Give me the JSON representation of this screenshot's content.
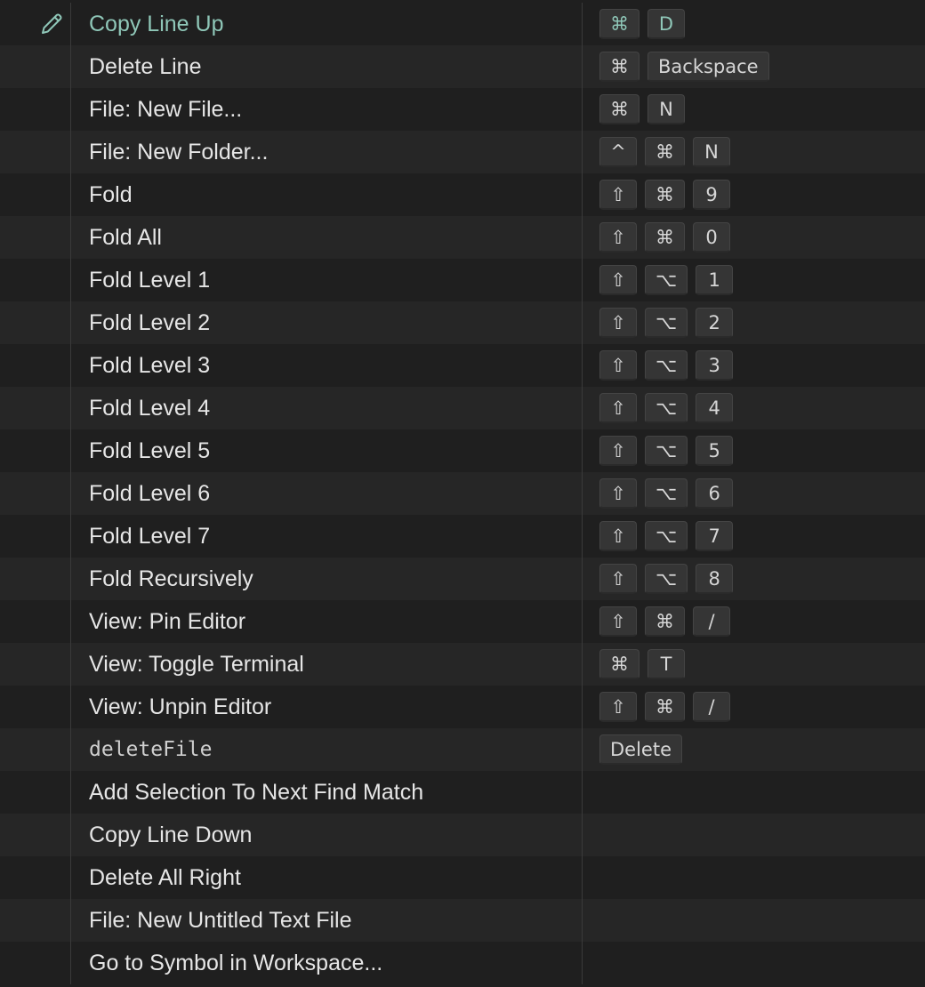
{
  "colors": {
    "background": "#1f1f1f",
    "row_alt": "#262626",
    "highlight_text": "#8fc7b8",
    "key_bg": "#353535"
  },
  "rows": [
    {
      "command": "Copy Line Up",
      "keys": [
        "⌘",
        "D"
      ],
      "style": "highlight",
      "edit_icon": "pencil-icon"
    },
    {
      "command": "Delete Line",
      "keys": [
        "⌘",
        "Backspace"
      ]
    },
    {
      "command": "File: New File...",
      "keys": [
        "⌘",
        "N"
      ]
    },
    {
      "command": "File: New Folder...",
      "keys": [
        "^",
        "⌘",
        "N"
      ]
    },
    {
      "command": "Fold",
      "keys": [
        "⇧",
        "⌘",
        "9"
      ]
    },
    {
      "command": "Fold All",
      "keys": [
        "⇧",
        "⌘",
        "0"
      ]
    },
    {
      "command": "Fold Level 1",
      "keys": [
        "⇧",
        "⌥",
        "1"
      ]
    },
    {
      "command": "Fold Level 2",
      "keys": [
        "⇧",
        "⌥",
        "2"
      ]
    },
    {
      "command": "Fold Level 3",
      "keys": [
        "⇧",
        "⌥",
        "3"
      ]
    },
    {
      "command": "Fold Level 4",
      "keys": [
        "⇧",
        "⌥",
        "4"
      ]
    },
    {
      "command": "Fold Level 5",
      "keys": [
        "⇧",
        "⌥",
        "5"
      ]
    },
    {
      "command": "Fold Level 6",
      "keys": [
        "⇧",
        "⌥",
        "6"
      ]
    },
    {
      "command": "Fold Level 7",
      "keys": [
        "⇧",
        "⌥",
        "7"
      ]
    },
    {
      "command": "Fold Recursively",
      "keys": [
        "⇧",
        "⌥",
        "8"
      ]
    },
    {
      "command": "View: Pin Editor",
      "keys": [
        "⇧",
        "⌘",
        "/"
      ]
    },
    {
      "command": "View: Toggle Terminal",
      "keys": [
        "⌘",
        "T"
      ]
    },
    {
      "command": "View: Unpin Editor",
      "keys": [
        "⇧",
        "⌘",
        "/"
      ]
    },
    {
      "command": "deleteFile",
      "keys": [
        "Delete"
      ],
      "style": "mono"
    },
    {
      "command": "Add Selection To Next Find Match",
      "keys": []
    },
    {
      "command": "Copy Line Down",
      "keys": []
    },
    {
      "command": "Delete All Right",
      "keys": []
    },
    {
      "command": "File: New Untitled Text File",
      "keys": []
    },
    {
      "command": "Go to Symbol in Workspace...",
      "keys": []
    }
  ]
}
